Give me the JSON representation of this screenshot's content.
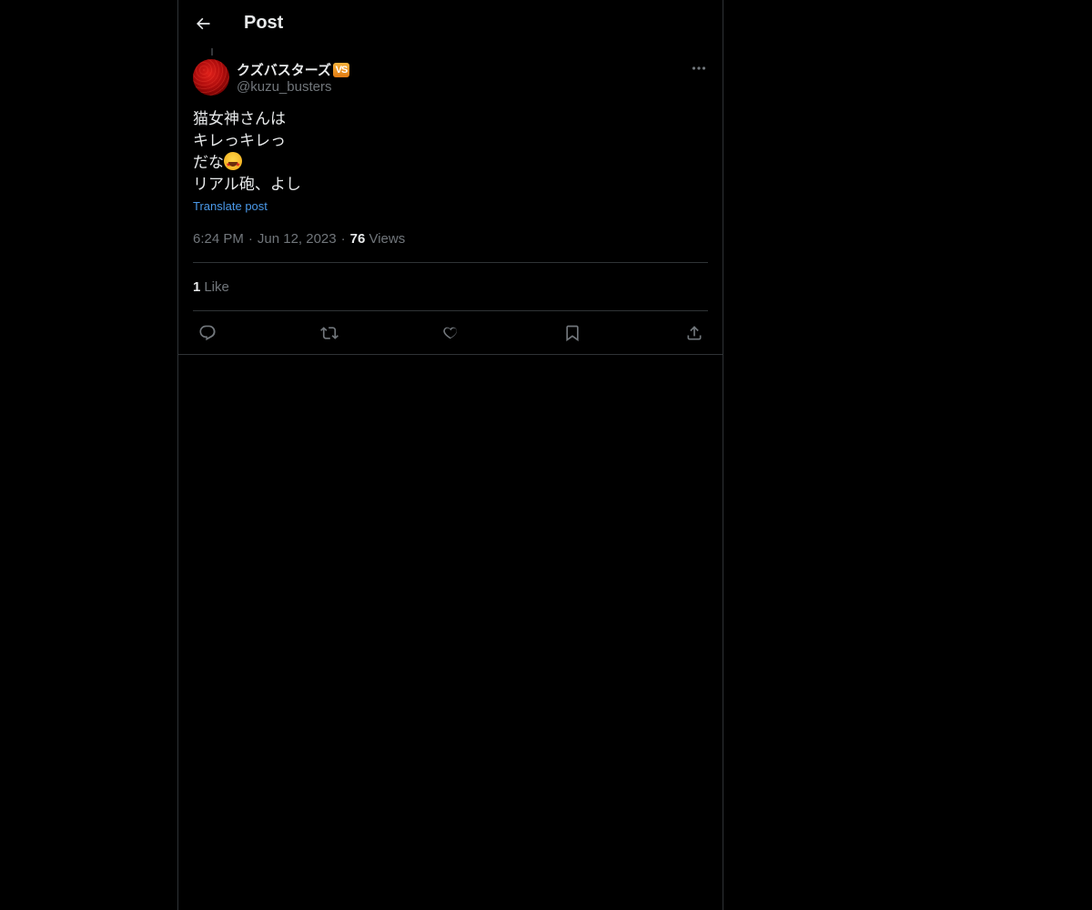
{
  "header": {
    "title": "Post",
    "back_icon": "arrow-left-icon"
  },
  "author": {
    "display_name": "クズバスターズ",
    "badge_text": "VS",
    "handle": "@kuzu_busters",
    "avatar_color": "#c41010"
  },
  "post": {
    "lines": [
      "猫女神さんは",
      "キレっキレっ",
      "だな",
      "リアル砲、よし"
    ],
    "emoji": "star-struck-emoji",
    "translate_label": "Translate post",
    "time": "6:24 PM",
    "dot": "·",
    "date": "Jun 12, 2023",
    "views_count": "76",
    "views_label": "Views"
  },
  "engagement": {
    "likes_count": "1",
    "likes_label": "Like"
  },
  "actions": [
    {
      "name": "reply",
      "icon": "reply-icon"
    },
    {
      "name": "repost",
      "icon": "repost-icon"
    },
    {
      "name": "like",
      "icon": "heart-icon"
    },
    {
      "name": "bookmark",
      "icon": "bookmark-icon"
    },
    {
      "name": "share",
      "icon": "share-icon"
    }
  ],
  "colors": {
    "background": "#000000",
    "text": "#e7e9ea",
    "secondary_text": "#71767b",
    "link": "#4a99e9",
    "border": "#2f3336"
  }
}
